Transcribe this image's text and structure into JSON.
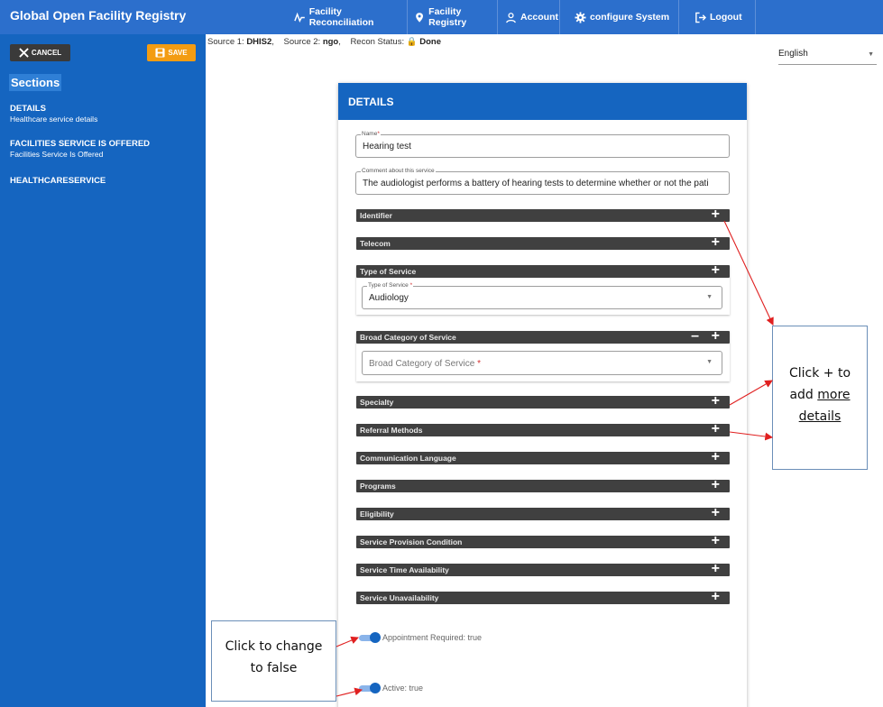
{
  "header": {
    "app_title": "Global Open Facility Registry",
    "nav": [
      {
        "label": "Facility Reconciliation",
        "icon": "reconciliation-icon"
      },
      {
        "label": "Facility Registry",
        "icon": "map-pin-icon"
      },
      {
        "label": "Account",
        "icon": "user-icon"
      },
      {
        "label": "configure System",
        "icon": "gear-icon"
      },
      {
        "label": "Logout",
        "icon": "logout-icon"
      }
    ]
  },
  "sidebar": {
    "cancel_label": "CANCEL",
    "save_label": "SAVE",
    "sections_title": "Sections",
    "sections": [
      {
        "title": "DETAILS",
        "subtitle": "Healthcare service details"
      },
      {
        "title": "FACILITIES SERVICE IS OFFERED",
        "subtitle": "Facilities Service Is Offered"
      },
      {
        "title": "HEALTHCARESERVICE",
        "subtitle": ""
      }
    ]
  },
  "source_info": {
    "source1_label": "Source 1:",
    "source1_value": "DHIS2",
    "source2_label": "Source 2:",
    "source2_value": "ngo",
    "recon_label": "Recon Status:",
    "recon_value": "Done"
  },
  "language": {
    "selected": "English"
  },
  "card": {
    "title": "DETAILS",
    "name_field": {
      "label": "Name",
      "value": "Hearing test"
    },
    "comment_field": {
      "label": "Comment about this service",
      "value": "The audiologist performs a battery of hearing tests to determine whether or not the pati"
    },
    "sections": {
      "identifier": "Identifier",
      "telecom": "Telecom",
      "type_of_service": "Type of Service",
      "broad_category": "Broad Category of Service",
      "specialty": "Specialty",
      "referral_methods": "Referral Methods",
      "communication_language": "Communication Language",
      "programs": "Programs",
      "eligibility": "Eligibility",
      "service_provision_condition": "Service Provision Condition",
      "service_time_availability": "Service Time Availability",
      "service_unavailability": "Service Unavailability"
    },
    "type_of_service_select": {
      "label": "Type of Service",
      "value": "Audiology"
    },
    "broad_category_select": {
      "placeholder": "Broad Category of Service"
    },
    "appointment_toggle": "Appointment Required: true",
    "active_toggle": "Active: true"
  },
  "annotations": {
    "callout_more_1": "Click + to",
    "callout_more_2": "add",
    "callout_more_3": "more",
    "callout_more_4": "details",
    "callout_toggle_1": "Click to change",
    "callout_toggle_2": "to false"
  },
  "colors": {
    "header": "#2c6fcc",
    "sidebar": "#1565c0",
    "save": "#f39c12",
    "bar": "#404040",
    "arrow": "#e02020"
  }
}
